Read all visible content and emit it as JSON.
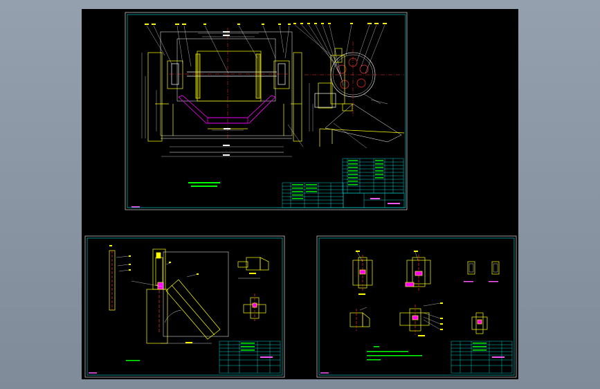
{
  "drawing": {
    "sheets": [
      {
        "id": "assembly",
        "label": ""
      },
      {
        "id": "parts-a",
        "label": ""
      },
      {
        "id": "parts-b",
        "label": ""
      }
    ]
  },
  "colors": {
    "background": "#000000",
    "viewport": "#8f9aa8",
    "border": "#ffffff",
    "frame": "#00e5e5",
    "geometry": "#ffff00",
    "section": "#ff00ff",
    "centerline": "#ff3030",
    "dimension": "#00ff00",
    "titleblock": "#00ffff"
  }
}
